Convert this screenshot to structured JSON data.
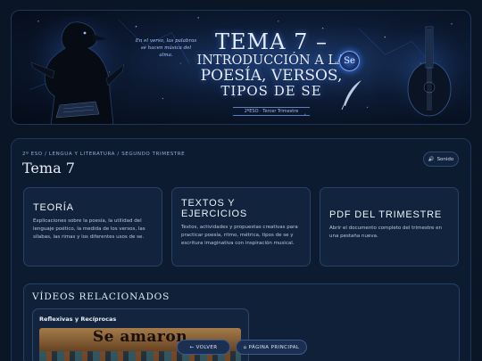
{
  "banner": {
    "quote": "En el verso, las palabras se hacen música del alma.",
    "title_line1": "TEMA 7 –",
    "title_line2": "INTRODUCCIÓN A LA",
    "title_line3": "POESÍA, VERSOS,",
    "title_line4": "TIPOS DE SE",
    "badge": "Se",
    "subtitle": "2ºESO · Tercer Trimestre"
  },
  "header": {
    "breadcrumb": "2º ESO / LENGUA Y LITERATURA / SEGUNDO TRIMESTRE",
    "title": "Tema 7",
    "sound_icon": "🔊",
    "sound_label": "Sonido"
  },
  "cards": [
    {
      "title": "TEORÍA",
      "description": "Explicaciones sobre la poesía, la utilidad del lenguaje poético, la medida de los versos, las sílabas, las rimas y los diferentes usos de se."
    },
    {
      "title": "TEXTOS Y EJERCICIOS",
      "description": "Textos, actividades y propuestas creativas para practicar poesía, ritmo, métrica, tipos de se y escritura imaginativa con inspiración musical."
    },
    {
      "title": "PDF DEL TRIMESTRE",
      "description": "Abrir el documento completo del trimestre en una pestaña nueva."
    }
  ],
  "videos": {
    "section_title": "VÍDEOS RELACIONADOS",
    "items": [
      {
        "label": "Reflexivas y Recíprocas",
        "thumb_text": "Se amaron"
      }
    ]
  },
  "nav": {
    "back_label": "← VOLVER",
    "home_label": "⌂ PÁGINA PRINCIPAL"
  }
}
